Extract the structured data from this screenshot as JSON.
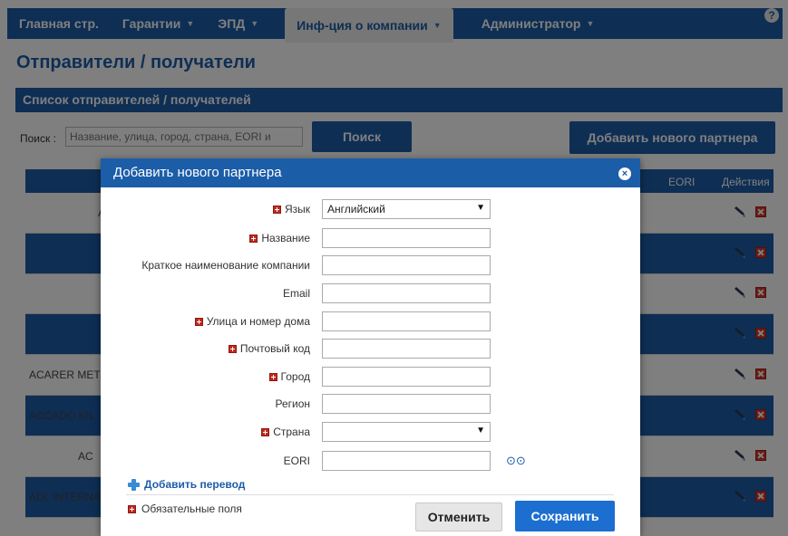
{
  "nav": {
    "items": [
      {
        "label": "Главная стр.",
        "caret": false
      },
      {
        "label": "Гарантии",
        "caret": true
      },
      {
        "label": "ЭПД",
        "caret": true
      },
      {
        "label": "Инф-ция о компании",
        "caret": true,
        "active": true
      },
      {
        "label": "Администратор",
        "caret": true
      }
    ],
    "help_label": "?"
  },
  "page": {
    "title": "Отправители / получатели",
    "panel_title": "Список отправителей / получателей",
    "search_label": "Поиск :",
    "search_placeholder": "Название, улица, город, страна, EORI и",
    "search_button": "Поиск",
    "add_partner_button": "Добавить нового партнера"
  },
  "table": {
    "headers": {
      "eori": "EORI",
      "actions": "Действия"
    },
    "rows": [
      {
        "name": "A"
      },
      {
        "name": ""
      },
      {
        "name": ""
      },
      {
        "name": ""
      },
      {
        "name": "ACARER MET"
      },
      {
        "name": "ACCADO KIL"
      },
      {
        "name": "AC"
      },
      {
        "name": "ADL INTERNAT"
      }
    ]
  },
  "modal": {
    "title": "Добавить нового партнера",
    "fields": [
      {
        "label": "Язык",
        "required": true,
        "type": "select",
        "value": "Английский"
      },
      {
        "label": "Название",
        "required": true,
        "type": "text",
        "value": ""
      },
      {
        "label": "Краткое наименование компании",
        "required": false,
        "type": "text",
        "value": ""
      },
      {
        "label": "Email",
        "required": false,
        "type": "text",
        "value": ""
      },
      {
        "label": "Улица и номер дома",
        "required": true,
        "type": "text",
        "value": ""
      },
      {
        "label": "Почтовый код",
        "required": true,
        "type": "text",
        "value": ""
      },
      {
        "label": "Город",
        "required": true,
        "type": "text",
        "value": ""
      },
      {
        "label": "Регион",
        "required": false,
        "type": "text",
        "value": ""
      },
      {
        "label": "Страна",
        "required": true,
        "type": "select",
        "value": ""
      },
      {
        "label": "EORI",
        "required": false,
        "type": "text",
        "value": ""
      }
    ],
    "add_translation": "Добавить перевод",
    "required_note": "Обязательные поля",
    "cancel_button": "Отменить",
    "save_button": "Сохранить"
  },
  "colors": {
    "primary": "#1c5da8",
    "required": "#c0281c",
    "save": "#1c6fd0"
  }
}
